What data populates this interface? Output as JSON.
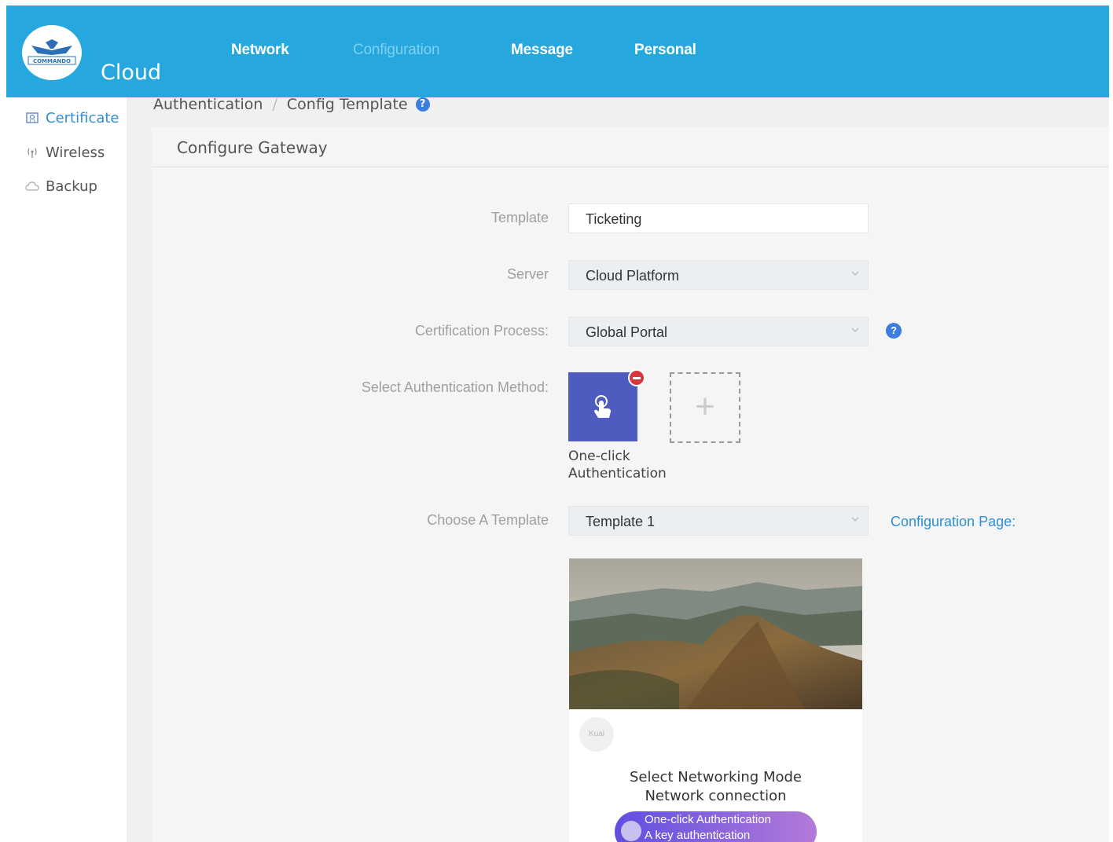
{
  "header": {
    "logo_text": "COMMANDO",
    "brand": "Cloud",
    "nav": [
      {
        "label": "Network",
        "active": true
      },
      {
        "label": "Configuration",
        "active": false
      },
      {
        "label": "Message",
        "active": true
      },
      {
        "label": "Personal",
        "active": true
      }
    ]
  },
  "sidebar": {
    "items": [
      {
        "label": "Certificate",
        "icon": "certificate-icon",
        "active": true
      },
      {
        "label": "Wireless",
        "icon": "wireless-icon",
        "active": false
      },
      {
        "label": "Backup",
        "icon": "cloud-icon",
        "active": false
      }
    ]
  },
  "breadcrumb": {
    "parent": "Authentication",
    "separator": "/",
    "current": "Config Template",
    "help": "?"
  },
  "form": {
    "title": "Configure Gateway",
    "template_label": "Template",
    "template_value": "Ticketing",
    "server_label": "Server",
    "server_value": "Cloud Platform",
    "process_label": "Certification Process:",
    "process_value": "Global Portal",
    "process_help": "?",
    "method_label": "Select Authentication Method:",
    "method_tile_caption": "One-click Authentication",
    "add_symbol": "+",
    "choose_template_label": "Choose A Template",
    "choose_template_value": "Template 1",
    "config_page_link": "Configuration Page:"
  },
  "preview": {
    "mini_logo": "Kuai",
    "title": "Select Networking Mode",
    "subtitle": "Network connection",
    "button_line1": "One-click Authentication",
    "button_line2": "A key authentication"
  },
  "colors": {
    "header": "#26a8df",
    "accent": "#2f8fd0",
    "auth_tile": "#4f5cbf",
    "remove_badge": "#d7363c"
  }
}
